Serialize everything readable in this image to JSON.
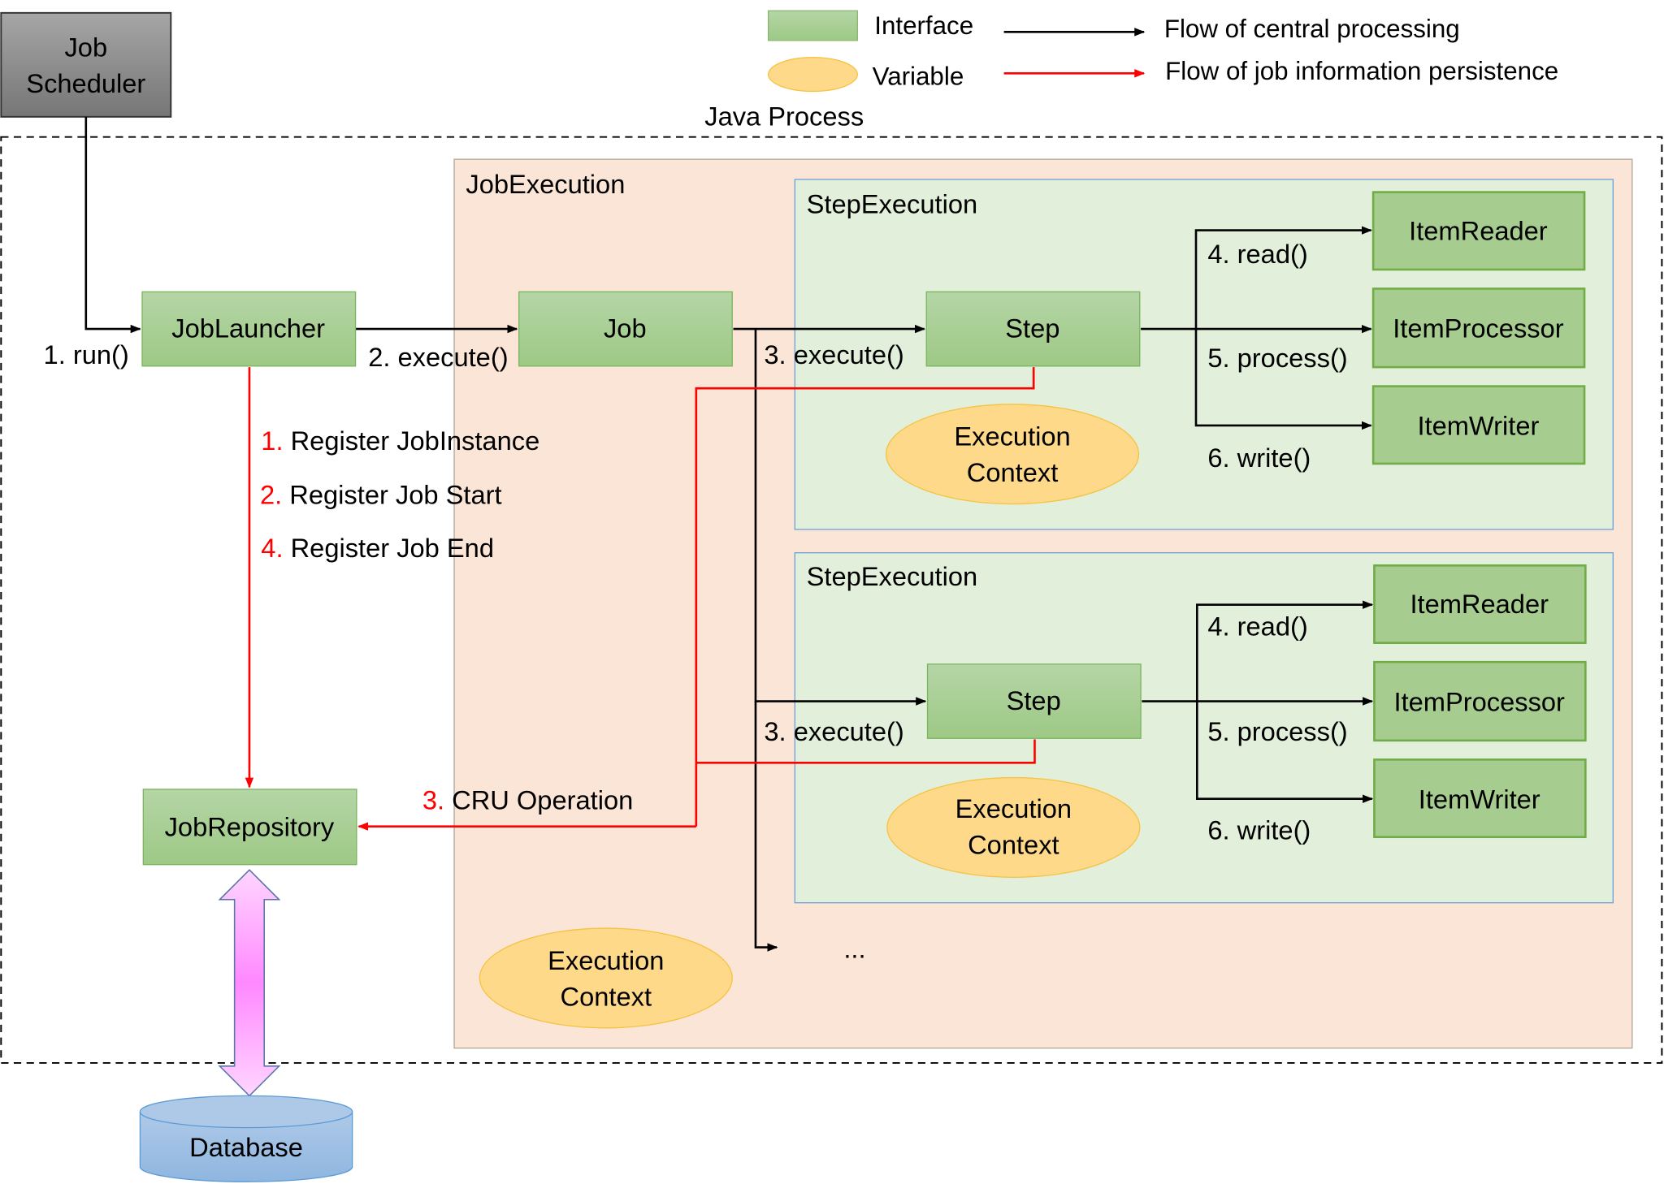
{
  "legend": {
    "interface_label": "Interface",
    "variable_label": "Variable",
    "central_flow_label": "Flow of central processing",
    "persistence_flow_label": "Flow of job information persistence"
  },
  "colors": {
    "interface": "#a9d18e",
    "variable": "#ffd98a",
    "job_execution_bg": "#fbe5d6",
    "step_execution_bg": "#e2efda",
    "persistence_arrow": "#ff0000",
    "central_arrow": "#000000",
    "database": "#9dc3e6",
    "scheduler": "#7f7f7f"
  },
  "job_scheduler": {
    "line1": "Job",
    "line2": "Scheduler"
  },
  "java_process_label": "Java Process",
  "job_launcher": "JobLauncher",
  "job_repository": "JobRepository",
  "database": "Database",
  "job_execution": {
    "title": "JobExecution",
    "job": "Job",
    "context_line1": "Execution",
    "context_line2": "Context",
    "ellipsis": "..."
  },
  "step_executions": [
    {
      "title": "StepExecution",
      "step": "Step",
      "context_line1": "Execution",
      "context_line2": "Context",
      "execute_label": "3. execute()",
      "reader": "ItemReader",
      "processor": "ItemProcessor",
      "writer": "ItemWriter",
      "read_label": "4. read()",
      "process_label": "5. process()",
      "write_label": "6. write()"
    },
    {
      "title": "StepExecution",
      "step": "Step",
      "context_line1": "Execution",
      "context_line2": "Context",
      "execute_label": "3. execute()",
      "reader": "ItemReader",
      "processor": "ItemProcessor",
      "writer": "ItemWriter",
      "read_label": "4. read()",
      "process_label": "5. process()",
      "write_label": "6. write()"
    }
  ],
  "flow_labels": {
    "run": "1. run()",
    "execute": "2. execute()"
  },
  "persistence_steps": [
    {
      "num": "1.",
      "text": " Register JobInstance"
    },
    {
      "num": "2.",
      "text": " Register Job Start"
    },
    {
      "num": "4.",
      "text": " Register Job End"
    }
  ],
  "cru": {
    "num": "3.",
    "text": " CRU Operation"
  }
}
